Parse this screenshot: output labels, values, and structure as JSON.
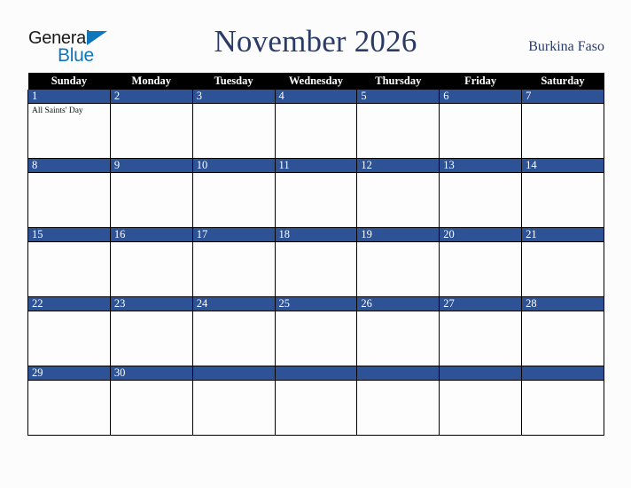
{
  "brand": {
    "name_top": "General",
    "name_bottom": "Blue",
    "triangle_icon": "triangle-icon",
    "color_top": "#1a1a1a",
    "color_bottom": "#1076bc"
  },
  "header": {
    "title": "November 2026",
    "country": "Burkina Faso",
    "title_color": "#2a3c66"
  },
  "calendar": {
    "month": "November",
    "year": "2026",
    "weekday_headers": [
      "Sunday",
      "Monday",
      "Tuesday",
      "Wednesday",
      "Thursday",
      "Friday",
      "Saturday"
    ],
    "header_bg": "#000000",
    "header_text_color": "#ffffff",
    "date_band_color": "#2d5295",
    "date_text_color": "#ffffff",
    "cell_bg": "#fdfdfd",
    "weeks": [
      [
        {
          "day": "1",
          "events": [
            "All Saints' Day"
          ]
        },
        {
          "day": "2",
          "events": []
        },
        {
          "day": "3",
          "events": []
        },
        {
          "day": "4",
          "events": []
        },
        {
          "day": "5",
          "events": []
        },
        {
          "day": "6",
          "events": []
        },
        {
          "day": "7",
          "events": []
        }
      ],
      [
        {
          "day": "8",
          "events": []
        },
        {
          "day": "9",
          "events": []
        },
        {
          "day": "10",
          "events": []
        },
        {
          "day": "11",
          "events": []
        },
        {
          "day": "12",
          "events": []
        },
        {
          "day": "13",
          "events": []
        },
        {
          "day": "14",
          "events": []
        }
      ],
      [
        {
          "day": "15",
          "events": []
        },
        {
          "day": "16",
          "events": []
        },
        {
          "day": "17",
          "events": []
        },
        {
          "day": "18",
          "events": []
        },
        {
          "day": "19",
          "events": []
        },
        {
          "day": "20",
          "events": []
        },
        {
          "day": "21",
          "events": []
        }
      ],
      [
        {
          "day": "22",
          "events": []
        },
        {
          "day": "23",
          "events": []
        },
        {
          "day": "24",
          "events": []
        },
        {
          "day": "25",
          "events": []
        },
        {
          "day": "26",
          "events": []
        },
        {
          "day": "27",
          "events": []
        },
        {
          "day": "28",
          "events": []
        }
      ],
      [
        {
          "day": "29",
          "events": []
        },
        {
          "day": "30",
          "events": []
        },
        {
          "day": "",
          "events": []
        },
        {
          "day": "",
          "events": []
        },
        {
          "day": "",
          "events": []
        },
        {
          "day": "",
          "events": []
        },
        {
          "day": "",
          "events": []
        }
      ]
    ]
  }
}
